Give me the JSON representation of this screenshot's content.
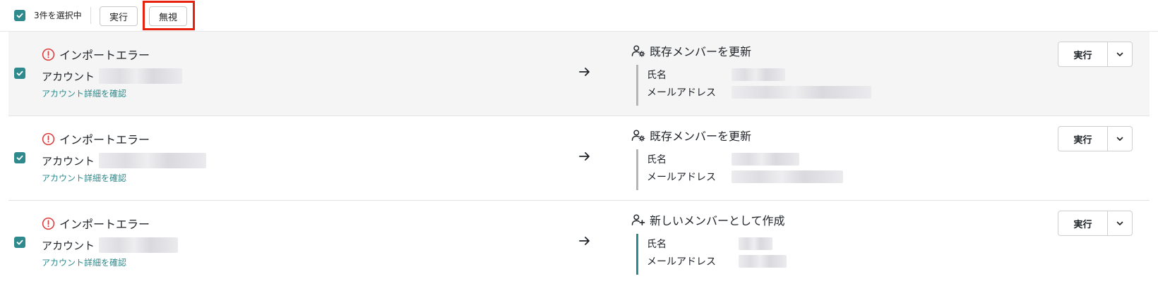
{
  "toolbar": {
    "selected_text": "3件を選択中",
    "execute_label": "実行",
    "ignore_label": "無視"
  },
  "rows": [
    {
      "status_title": "インポートエラー",
      "account_label": "アカウント",
      "account_link": "アカウント詳細を確認",
      "action_title": "既存メンバーを更新",
      "action_icon": "user-gear-icon",
      "name_label": "氏名",
      "email_label": "メールアドレス",
      "execute_label": "実行"
    },
    {
      "status_title": "インポートエラー",
      "account_label": "アカウント",
      "account_link": "アカウント詳細を確認",
      "action_title": "既存メンバーを更新",
      "action_icon": "user-gear-icon",
      "name_label": "氏名",
      "email_label": "メールアドレス",
      "execute_label": "実行"
    },
    {
      "status_title": "インポートエラー",
      "account_label": "アカウント",
      "account_link": "アカウント詳細を確認",
      "action_title": "新しいメンバーとして作成",
      "action_icon": "user-plus-icon",
      "name_label": "氏名",
      "email_label": "メールアドレス",
      "execute_label": "実行"
    }
  ],
  "colors": {
    "accent": "#2e8a8c",
    "error": "#d93a3a",
    "highlight": "#e8210f"
  }
}
